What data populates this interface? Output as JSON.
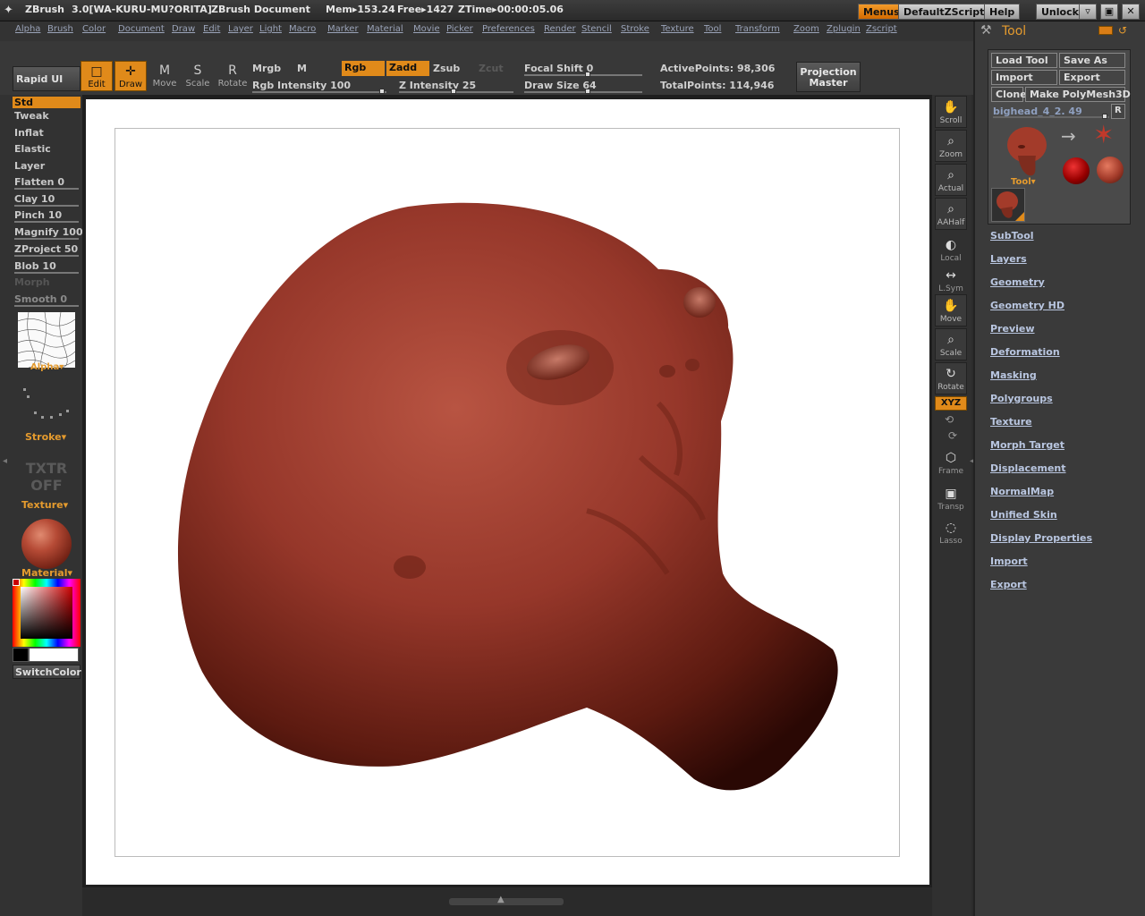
{
  "titlebar": {
    "app": "ZBrush",
    "version": "3.0[WA-KURU-MU?ORITA]",
    "document": "ZBrush Document",
    "mem": "Mem▸153.24",
    "free": "Free▸1427",
    "ztime": "ZTime▸00:00:05.06",
    "buttons": {
      "menus": "Menus",
      "script": "DefaultZScript",
      "help": "Help",
      "unlock": "Unlock"
    }
  },
  "menubar": [
    "Alpha",
    "Brush",
    "Color",
    "Document",
    "Draw",
    "Edit",
    "Layer",
    "Light",
    "Macro",
    "Marker",
    "Material",
    "Movie",
    "Picker",
    "Preferences",
    "Render",
    "Stencil",
    "Stroke",
    "Texture",
    "Tool",
    "Transform",
    "Zoom",
    "Zplugin",
    "Zscript"
  ],
  "topshelf": {
    "rapid_ui": "Rapid UI",
    "tools": [
      {
        "label": "Edit",
        "icon": "□",
        "on": true
      },
      {
        "label": "Draw",
        "icon": "✛",
        "on": true
      },
      {
        "label": "Move",
        "icon": "M",
        "on": false
      },
      {
        "label": "Scale",
        "icon": "S",
        "on": false
      },
      {
        "label": "Rotate",
        "icon": "R",
        "on": false
      }
    ],
    "mrgb": "Mrgb",
    "m": "M",
    "rgb": "Rgb",
    "zadd": "Zadd",
    "zsub": "Zsub",
    "zcut": "Zcut",
    "rgb_intensity": "Rgb Intensity 100",
    "z_intensity": "Z Intensity 25",
    "focal_shift": "Focal Shift 0",
    "draw_size": "Draw Size 64",
    "active_points": "ActivePoints: 98,306",
    "total_points": "TotalPoints: 114,946",
    "projection_master": [
      "Projection",
      "Master"
    ]
  },
  "leftpanel": {
    "brushes": [
      {
        "label": "Std",
        "selected": true
      },
      {
        "label": "Tweak"
      },
      {
        "label": "Inflat"
      },
      {
        "label": "Elastic"
      },
      {
        "label": "Layer"
      },
      {
        "label": "Flatten 0"
      },
      {
        "label": "Clay 10"
      },
      {
        "label": "Pinch 10"
      },
      {
        "label": "Magnify 100"
      },
      {
        "label": "ZProject 50"
      },
      {
        "label": "Blob 10"
      },
      {
        "label": "Morph"
      },
      {
        "label": "Smooth 0"
      }
    ],
    "alpha_label": "Alpha▾",
    "stroke_label": "Stroke▾",
    "txtr_off": [
      "TXTR",
      "OFF"
    ],
    "texture_label": "Texture▾",
    "material_label": "Material▾",
    "switch_color": "SwitchColor"
  },
  "rightshelf": [
    {
      "label": "Scroll",
      "icon": "✋"
    },
    {
      "label": "Zoom",
      "icon": "⌕"
    },
    {
      "label": "Actual",
      "icon": "⌕"
    },
    {
      "label": "AAHalf",
      "icon": "⌕"
    },
    {
      "label": "Local",
      "icon": "◐"
    },
    {
      "label": "L.Sym",
      "icon": "↔"
    },
    {
      "label": "Move",
      "icon": "✋"
    },
    {
      "label": "Scale",
      "icon": "⌕"
    },
    {
      "label": "Rotate",
      "icon": "↻"
    },
    {
      "label": "XYZ",
      "icon": ""
    },
    {
      "label": "Frame",
      "icon": "⬡"
    },
    {
      "label": "Transp",
      "icon": "▣"
    },
    {
      "label": "Lasso",
      "icon": "◌"
    }
  ],
  "tray": {
    "title": "Tool",
    "buttons": {
      "load": "Load Tool",
      "save": "Save As",
      "import": "Import",
      "export": "Export",
      "clone": "Clone",
      "make": "Make PolyMesh3D",
      "r": "R"
    },
    "mesh_name": "bighead_4_2. 49",
    "tool_label": "Tool▾",
    "subpalettes": [
      "SubTool",
      "Layers",
      "Geometry",
      "Geometry HD",
      "Preview",
      "Deformation",
      "Masking",
      "Polygroups",
      "Texture",
      "Morph Target",
      "Displacement",
      "NormalMap",
      "Unified Skin",
      "Display Properties",
      "Import",
      "Export"
    ]
  }
}
